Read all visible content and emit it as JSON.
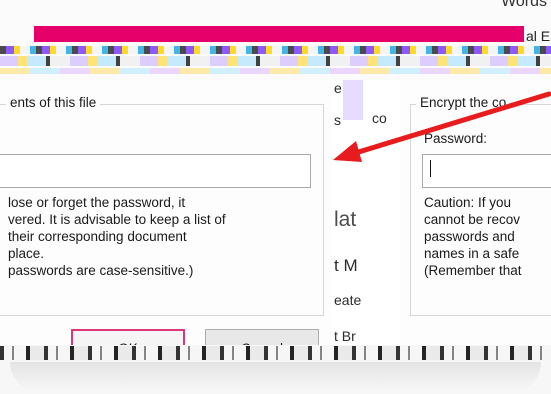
{
  "background_app": {
    "top_right_text": "Words",
    "tab_fragment": "al E",
    "column_fragments": [
      "e",
      "s",
      "co",
      "lat",
      "t M",
      "eate",
      "t Br"
    ]
  },
  "left_dialog": {
    "group_title": "ents of this file",
    "password_value": "",
    "caution_lines": [
      "lose or forget the password, it",
      "vered. It is advisable to keep a list of",
      " their corresponding document",
      " place.",
      " passwords are case-sensitive.)"
    ],
    "ok_label": "OK",
    "cancel_label": "Cancel"
  },
  "right_dialog": {
    "group_title": "Encrypt the co",
    "password_label": "Password:",
    "password_value": "",
    "caution_lines": [
      "Caution: If you",
      "cannot be recov",
      "passwords and",
      "names in a safe",
      "(Remember that"
    ]
  },
  "colors": {
    "highlight_pink": "#e5006a",
    "arrow_red": "#e81c1c",
    "ok_border": "#e0357a"
  }
}
